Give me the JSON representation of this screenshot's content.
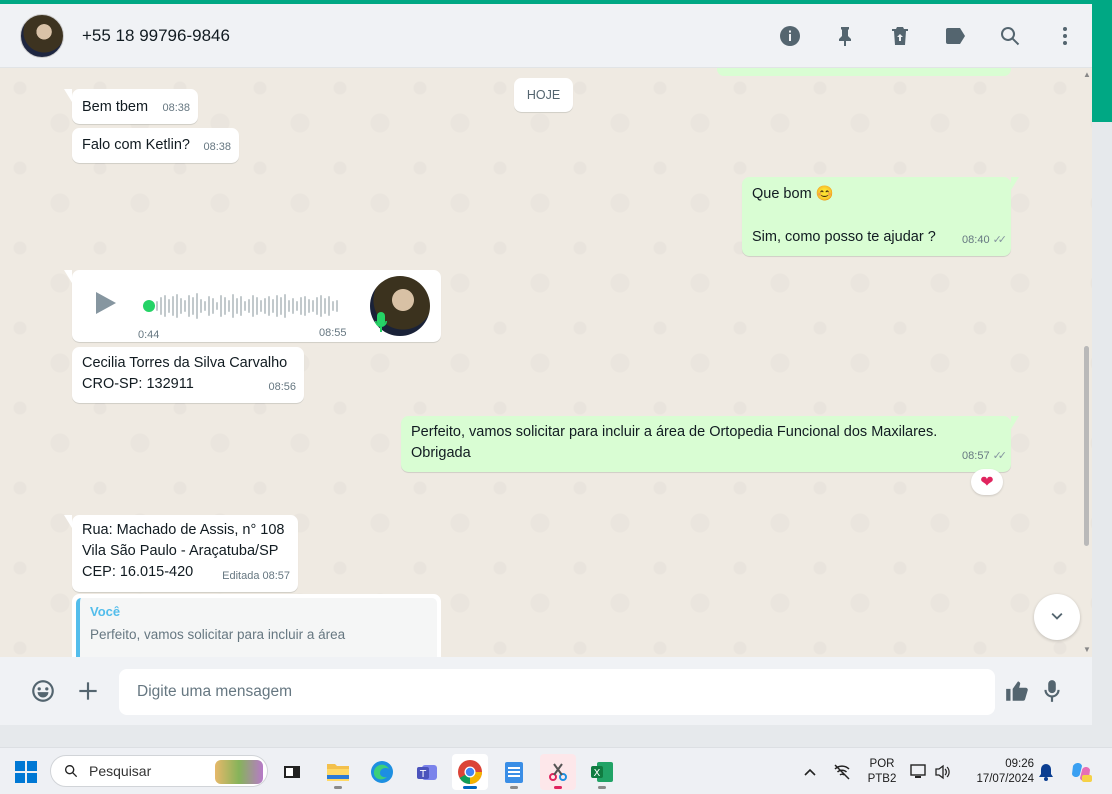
{
  "header": {
    "contact": "+55 18 99796-9846",
    "icons": [
      "info-icon",
      "pin-icon",
      "delete-icon",
      "label-icon",
      "search-icon",
      "menu-icon"
    ]
  },
  "chat": {
    "date_chip": "HOJE",
    "messages": [
      {
        "dir": "in",
        "text": "Bem tbem",
        "time": "08:38"
      },
      {
        "dir": "in",
        "text": "Falo com Ketlin?",
        "time": "08:38"
      },
      {
        "dir": "out",
        "line1": "Que bom 😊",
        "line2": "Sim, como posso te ajudar ?",
        "time": "08:40"
      },
      {
        "dir": "in",
        "type": "audio",
        "duration": "0:44",
        "time": "08:55"
      },
      {
        "dir": "in",
        "line1": "Cecilia Torres da Silva Carvalho",
        "line2": "CRO-SP: 132911",
        "time": "08:56"
      },
      {
        "dir": "out",
        "line1": "Perfeito, vamos solicitar para incluir a área de Ortopedia Funcional dos Maxilares.",
        "line2": "Obrigada",
        "time": "08:57",
        "reaction": "❤"
      },
      {
        "dir": "in",
        "line1": "Rua: Machado de Assis, n° 108",
        "line2": "Vila São Paulo - Araçatuba/SP",
        "line3": "CEP: 16.015-420",
        "edited": "Editada",
        "time": "08:57"
      },
      {
        "dir": "in",
        "type": "reply",
        "quote_author": "Você",
        "quote_text": "Perfeito, vamos solicitar para incluir a área"
      }
    ]
  },
  "composer": {
    "placeholder": "Digite uma mensagem"
  },
  "taskbar": {
    "search_label": "Pesquisar",
    "lang_line1": "POR",
    "lang_line2": "PTB2",
    "clock_time": "09:26",
    "clock_date": "17/07/2024"
  },
  "colors": {
    "accent": "#00a884",
    "outgoing_bubble": "#d9fdd3",
    "chat_background": "#efeae2",
    "panel": "#f0f2f5"
  }
}
